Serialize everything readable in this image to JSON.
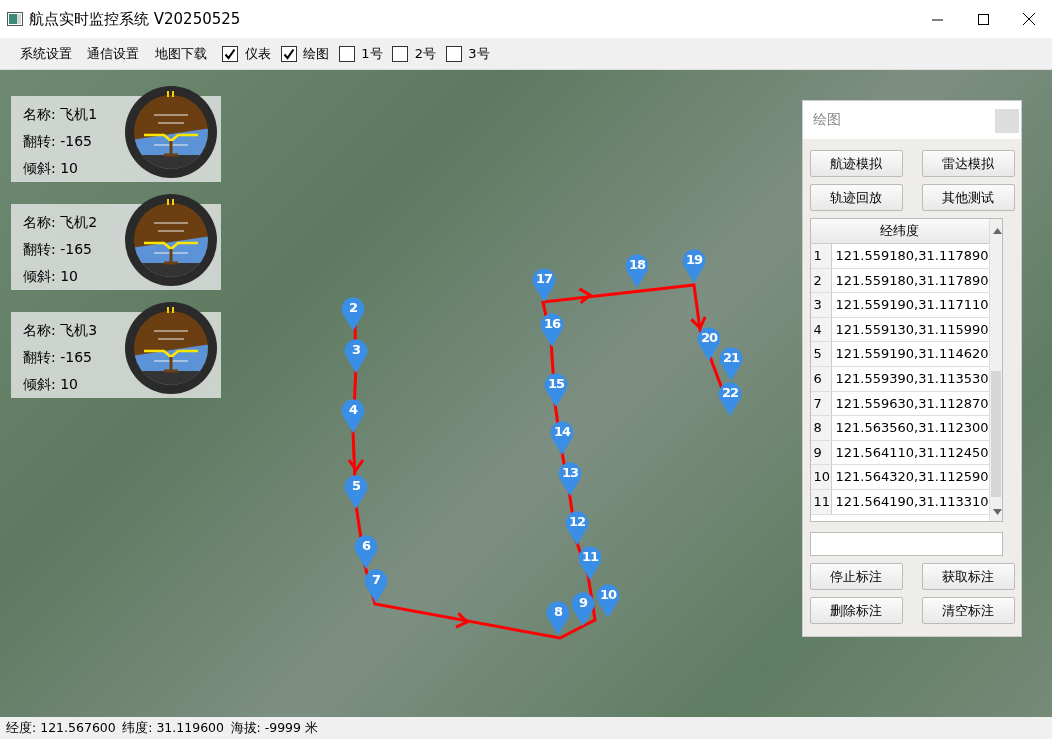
{
  "window": {
    "title": "航点实时监控系统 V20250525"
  },
  "toolbar": {
    "actions": [
      "系统设置",
      "通信设置",
      "地图下载"
    ],
    "toggles": [
      {
        "label": "仪表",
        "checked": true
      },
      {
        "label": "绘图",
        "checked": true
      },
      {
        "label": "1号",
        "checked": false
      },
      {
        "label": "2号",
        "checked": false
      },
      {
        "label": "3号",
        "checked": false
      }
    ]
  },
  "aircraft": [
    {
      "name": "名称: 飞机1",
      "roll": "翻转: -165",
      "pitch": "倾斜: 10"
    },
    {
      "name": "名称: 飞机2",
      "roll": "翻转: -165",
      "pitch": "倾斜: 10"
    },
    {
      "name": "名称: 飞机3",
      "roll": "翻转: -165",
      "pitch": "倾斜: 10"
    }
  ],
  "markers": [
    {
      "label": "2"
    },
    {
      "label": "3"
    },
    {
      "label": "4"
    },
    {
      "label": "5"
    },
    {
      "label": "6"
    },
    {
      "label": "7"
    },
    {
      "label": "8"
    },
    {
      "label": "9"
    },
    {
      "label": "10"
    },
    {
      "label": "17"
    },
    {
      "label": "16"
    },
    {
      "label": "15"
    },
    {
      "label": "14"
    },
    {
      "label": "13"
    },
    {
      "label": "12"
    },
    {
      "label": "11"
    },
    {
      "label": "18"
    },
    {
      "label": "19"
    },
    {
      "label": "20"
    },
    {
      "label": "21"
    },
    {
      "label": "22"
    }
  ],
  "panel": {
    "title": "绘图",
    "top_buttons": [
      "航迹模拟",
      "雷达模拟",
      "轨迹回放",
      "其他测试"
    ],
    "table": {
      "columns": [
        "经纬度"
      ],
      "rows": [
        {
          "index": "1",
          "value": "121.559180,31.117890"
        },
        {
          "index": "2",
          "value": "121.559180,31.117890"
        },
        {
          "index": "3",
          "value": "121.559190,31.117110"
        },
        {
          "index": "4",
          "value": "121.559130,31.115990"
        },
        {
          "index": "5",
          "value": "121.559190,31.114620"
        },
        {
          "index": "6",
          "value": "121.559390,31.113530"
        },
        {
          "index": "7",
          "value": "121.559630,31.112870"
        },
        {
          "index": "8",
          "value": "121.563560,31.112300"
        },
        {
          "index": "9",
          "value": "121.564110,31.112450"
        },
        {
          "index": "10",
          "value": "121.564320,31.112590"
        },
        {
          "index": "11",
          "value": "121.564190,31.113310"
        }
      ]
    },
    "bottom_buttons": [
      "停止标注",
      "获取标注",
      "删除标注",
      "清空标注"
    ]
  },
  "status_bar": {
    "longitude": "经度: 121.567600",
    "latitude": "纬度: 31.119600",
    "altitude": "海拔: -9999 米"
  }
}
